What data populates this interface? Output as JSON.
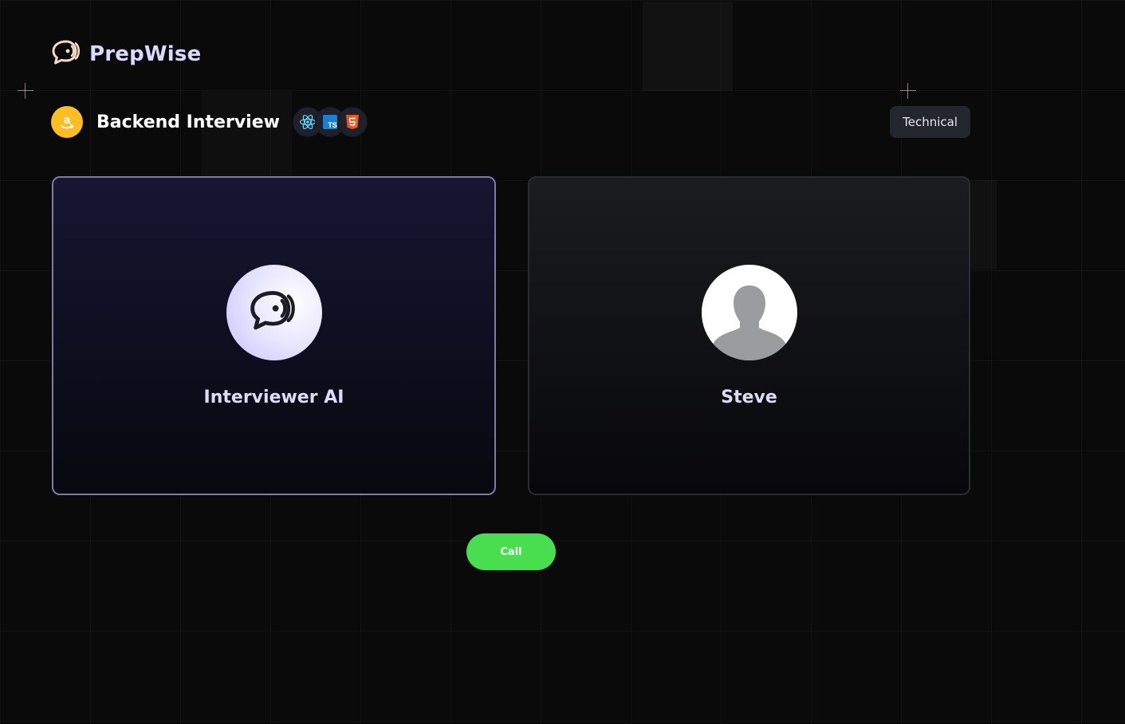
{
  "brand": {
    "name": "PrepWise",
    "logo_icon": "chat-bubble-wave-icon"
  },
  "interview": {
    "title": "Backend Interview",
    "company_icon": "amazon-icon",
    "tech_stack": [
      "react-icon",
      "typescript-icon",
      "html5-icon"
    ],
    "type_badge": "Technical"
  },
  "participants": {
    "ai": {
      "name": "Interviewer AI",
      "icon": "chat-bubble-wave-icon"
    },
    "user": {
      "name": "Steve",
      "icon": "user-silhouette-icon"
    }
  },
  "actions": {
    "call_label": "Call"
  },
  "colors": {
    "background": "#0a0a0a",
    "brand_text": "#dcd9ff",
    "call_button": "#49de50",
    "ai_card_border": "#7f7ba8",
    "company_badge": "#fbbf24"
  }
}
